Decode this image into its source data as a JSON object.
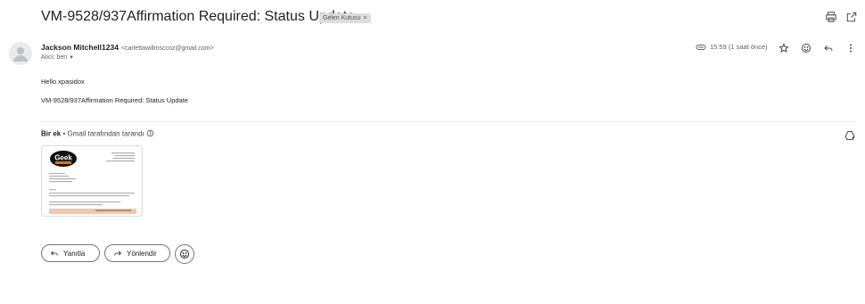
{
  "email": {
    "subject": "VM-9528/937Affirmation Required: Status Update",
    "label": "Gelen Kutusu",
    "label_close": "×",
    "sender_name": "Jackson Mitchell1234",
    "sender_email": "<carlettawillmsccoz@gmail.com>",
    "to_line": "Alıcı: ben",
    "timestamp": "15:59 (1 saat önce)",
    "body": [
      "Hello  xpasidox",
      "VM-9528/937Affirmation Required: Status Update"
    ]
  },
  "attachments": {
    "count_label": "Bir ek",
    "scanned_note": "• Gmail tarafından tarandı",
    "thumbnail_logo_text": "Geek"
  },
  "actions": {
    "reply_label": "Yanıtla",
    "forward_label": "Yönlendir"
  },
  "icons": {
    "print": "print-icon",
    "open_new_window": "open-in-new-icon",
    "avatar": "person-icon",
    "label": "label-icon",
    "star": "star-icon",
    "emoji": "emoji-icon",
    "reply": "reply-icon",
    "more": "more-vert-icon",
    "info": "info-icon",
    "drive_add": "add-to-drive-icon",
    "forward": "forward-icon"
  },
  "colors": {
    "text": "#1f1f1f",
    "muted": "#5f6368",
    "chip": "#dddddd",
    "thumb_logo": "#111111",
    "thumb_banner": "#f3c7a8"
  }
}
